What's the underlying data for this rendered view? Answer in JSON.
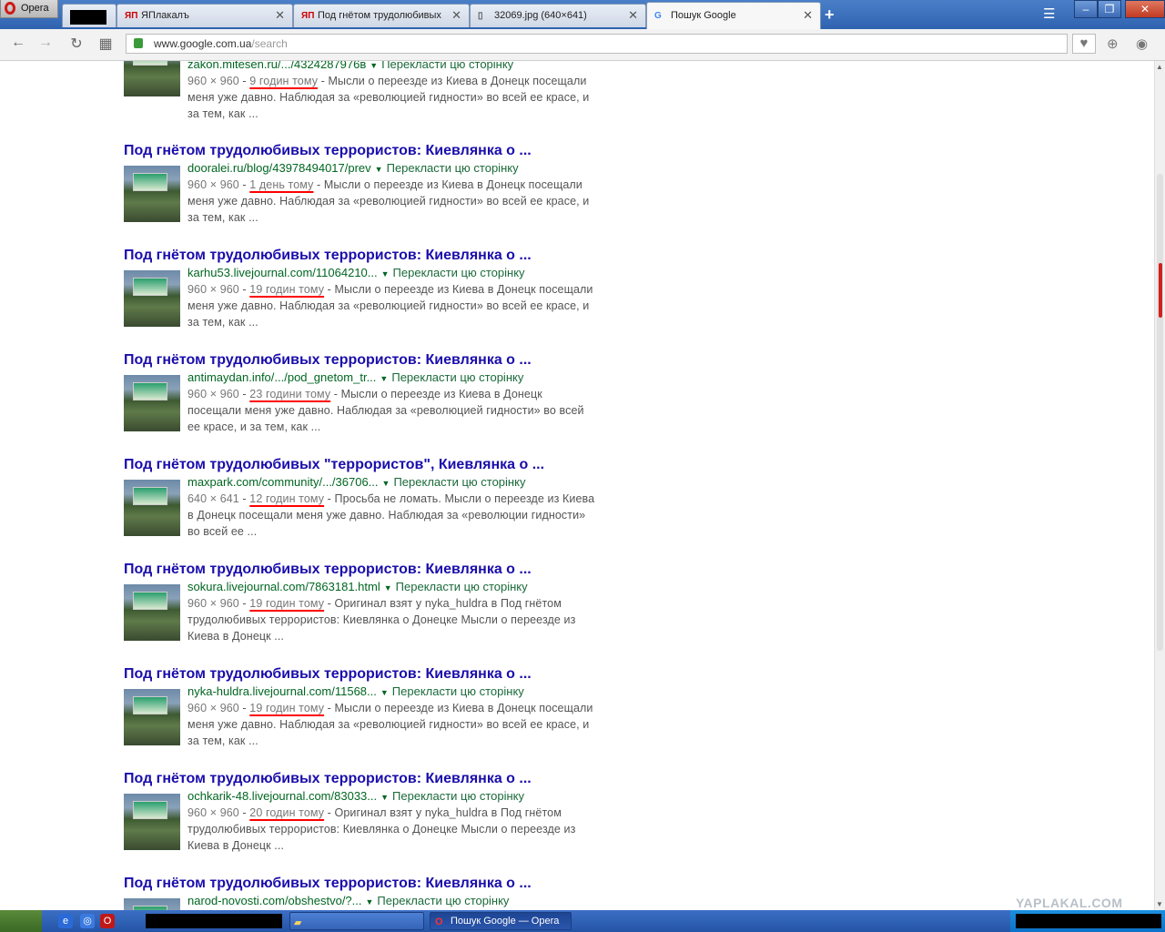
{
  "browser": {
    "menu_label": "Opera",
    "new_tab_symbol": "+",
    "tabs": [
      {
        "label": "",
        "icon": "redacted-icon"
      },
      {
        "label": "ЯПлакалъ",
        "icon": "yaplakal-icon"
      },
      {
        "label": "Под гнётом трудолюбивых",
        "icon": "yaplakal-icon"
      },
      {
        "label": "32069.jpg (640×641)",
        "icon": "document-icon"
      },
      {
        "label": "Пошук Google",
        "icon": "google-icon"
      }
    ],
    "url_host": "www.google.com.ua",
    "url_path": "/search"
  },
  "results": [
    {
      "title": "",
      "url": "zakon.mitesen.ru/.../4324287976в",
      "translate": "Перекласти цю сторінку",
      "size": "960 × 960",
      "when": "9 годин тому",
      "snippet": "Мысли о переезде из Киева в Донецк посещали меня уже давно. Наблюдая за «революцией гидности» во всей ее красе, и за тем, как ..."
    },
    {
      "title": "Под гнётом трудолюбивых террористов: Киевлянка о ...",
      "url": "dooralei.ru/blog/43978494017/prev",
      "translate": "Перекласти цю сторінку",
      "size": "960 × 960",
      "when": "1 день тому",
      "snippet": "Мысли о переезде из Киева в Донецк посещали меня уже давно. Наблюдая за «революцией гидности» во всей ее красе, и за тем, как ..."
    },
    {
      "title": "Под гнётом трудолюбивых террористов: Киевлянка о ...",
      "url": "karhu53.livejournal.com/11064210...",
      "translate": "Перекласти цю сторінку",
      "size": "960 × 960",
      "when": "19 годин тому",
      "snippet": "Мысли о переезде из Киева в Донецк посещали меня уже давно. Наблюдая за «революцией гидности» во всей ее красе, и за тем, как ..."
    },
    {
      "title": "Под гнётом трудолюбивых террористов: Киевлянка о ...",
      "url": "antimaydan.info/.../pod_gnetom_tr...",
      "translate": "Перекласти цю сторінку",
      "size": "960 × 960",
      "when": "23 години тому",
      "snippet": "Мысли о переезде из Киева в Донецк посещали меня уже давно. Наблюдая за «революцией гидности» во всей ее красе, и за тем, как ..."
    },
    {
      "title": "Под гнётом трудолюбивых \"террористов\", Киевлянка о ...",
      "url": "maxpark.com/community/.../36706...",
      "translate": "Перекласти цю сторінку",
      "size": "640 × 641",
      "when": "12 годин тому",
      "snippet": "Просьба не ломать. Мысли о переезде из Киева в Донецк посещали меня уже давно. Наблюдая за «революции гидности» во всей ее ..."
    },
    {
      "title": "Под гнётом трудолюбивых террористов: Киевлянка о ...",
      "url": "sokura.livejournal.com/7863181.html",
      "translate": "Перекласти цю сторінку",
      "size": "960 × 960",
      "when": "19 годин тому",
      "snippet": "Оригинал взят у nyka_huldra в Под гнётом трудолюбивых террористов: Киевлянка о Донецке Мысли о переезде из Киева в Донецк ..."
    },
    {
      "title": "Под гнётом трудолюбивых террористов: Киевлянка о ...",
      "url": "nyka-huldra.livejournal.com/11568...",
      "translate": "Перекласти цю сторінку",
      "size": "960 × 960",
      "when": "19 годин тому",
      "snippet": "Мысли о переезде из Киева в Донецк посещали меня уже давно. Наблюдая за «революцией гидности» во всей ее красе, и за тем, как ..."
    },
    {
      "title": "Под гнётом трудолюбивых террористов: Киевлянка о ...",
      "url": "ochkarik-48.livejournal.com/83033...",
      "translate": "Перекласти цю сторінку",
      "size": "960 × 960",
      "when": "20 годин тому",
      "snippet": "Оригинал взят у nyka_huldra в Под гнётом трудолюбивых террористов: Киевлянка о Донецке Мысли о переезде из Киева в Донецк ..."
    },
    {
      "title": "Под гнётом трудолюбивых террористов: Киевлянка о ...",
      "url": "narod-novosti.com/obshestvo/?...",
      "translate": "Перекласти цю сторінку",
      "size": "",
      "when": "",
      "snippet": ""
    }
  ],
  "taskbar": {
    "folder_task": "",
    "opera_task": "Пошук Google — Opera"
  },
  "watermark": "YAPLAKAL.COM"
}
